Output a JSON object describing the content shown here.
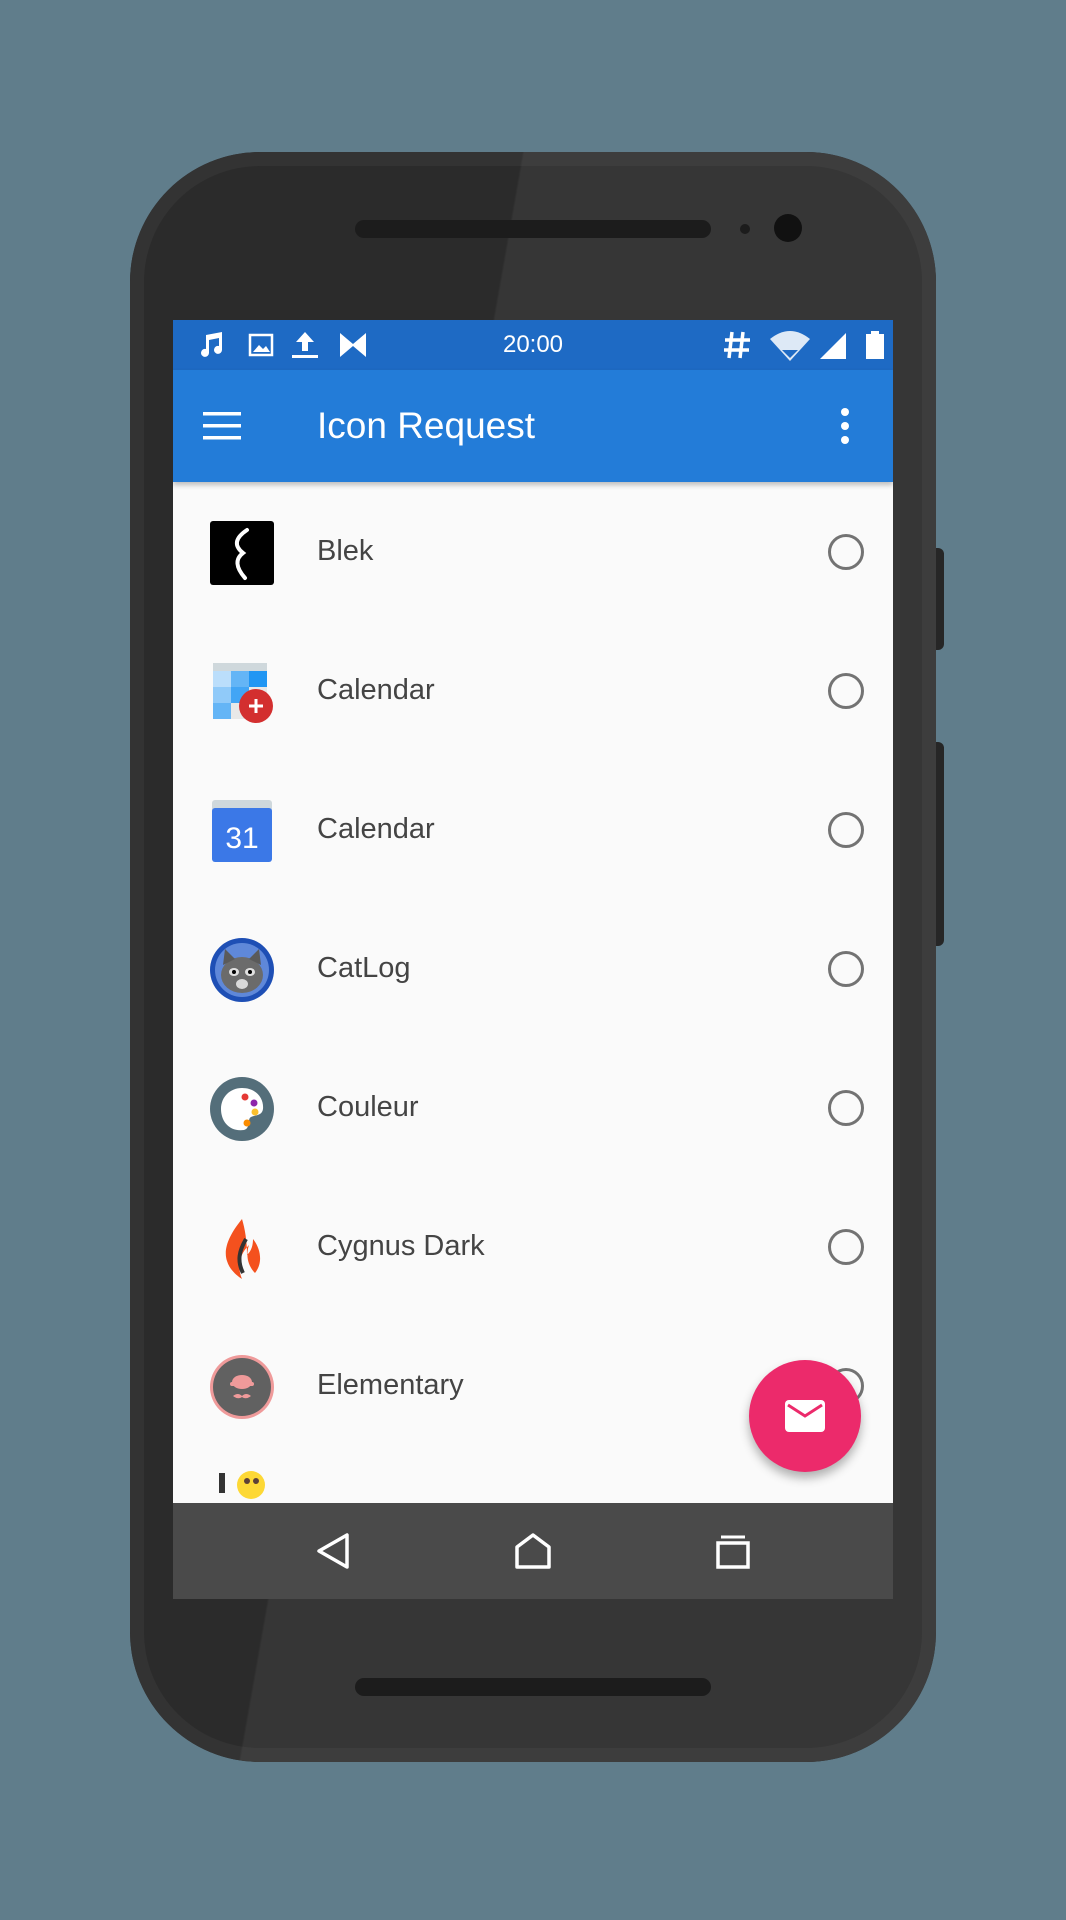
{
  "status_bar": {
    "time": "20:00",
    "left_icons": [
      "music-note-icon",
      "image-icon",
      "upload-icon",
      "app-notification-icon"
    ],
    "right_icons": [
      "hash-icon",
      "wifi-icon",
      "signal-icon",
      "battery-icon"
    ]
  },
  "toolbar": {
    "title": "Icon Request",
    "menu_icon": "hamburger-menu-icon",
    "overflow_icon": "more-vert-icon"
  },
  "apps": [
    {
      "name": "Blek",
      "icon": "blek-app-icon",
      "selected": false
    },
    {
      "name": "Calendar",
      "icon": "calendar-add-app-icon",
      "selected": false
    },
    {
      "name": "Calendar",
      "icon": "google-calendar-app-icon",
      "icon_text": "31",
      "selected": false
    },
    {
      "name": "CatLog",
      "icon": "catlog-app-icon",
      "selected": false
    },
    {
      "name": "Couleur",
      "icon": "couleur-palette-app-icon",
      "selected": false
    },
    {
      "name": "Cygnus Dark",
      "icon": "cygnus-flame-app-icon",
      "selected": false
    },
    {
      "name": "Elementary",
      "icon": "elementary-app-icon",
      "selected": false
    }
  ],
  "fab": {
    "icon": "email-icon"
  },
  "nav_bar": {
    "icons": [
      "back-icon",
      "home-icon",
      "recents-icon"
    ]
  },
  "colors": {
    "status_bar": "#1e6ac4",
    "toolbar": "#237cd8",
    "fab": "#ec2a6b",
    "background": "#607d8b"
  }
}
